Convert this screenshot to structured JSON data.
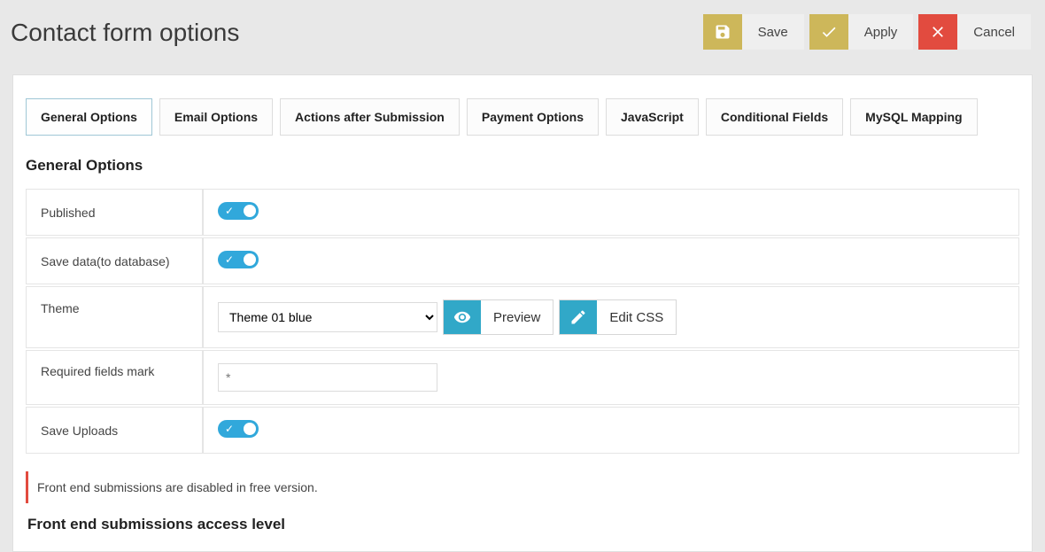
{
  "header": {
    "title": "Contact form options"
  },
  "toolbar": {
    "save_label": "Save",
    "apply_label": "Apply",
    "cancel_label": "Cancel"
  },
  "tabs": [
    {
      "id": "general",
      "label": "General Options",
      "active": true
    },
    {
      "id": "email",
      "label": "Email Options",
      "active": false
    },
    {
      "id": "actions",
      "label": "Actions after Submission",
      "active": false
    },
    {
      "id": "payment",
      "label": "Payment Options",
      "active": false
    },
    {
      "id": "javascript",
      "label": "JavaScript",
      "active": false
    },
    {
      "id": "conditional",
      "label": "Conditional Fields",
      "active": false
    },
    {
      "id": "mysql",
      "label": "MySQL Mapping",
      "active": false
    }
  ],
  "section": {
    "heading": "General Options",
    "rows": {
      "published": {
        "label": "Published",
        "on": true
      },
      "save_data": {
        "label": "Save data(to database)",
        "on": true
      },
      "theme": {
        "label": "Theme",
        "selected": "Theme 01 blue",
        "preview_label": "Preview",
        "editcss_label": "Edit CSS"
      },
      "required_mark": {
        "label": "Required fields mark",
        "placeholder": "*",
        "value": ""
      },
      "save_uploads": {
        "label": "Save Uploads",
        "on": true
      }
    }
  },
  "notice": "Front end submissions are disabled in free version.",
  "subsection": {
    "heading": "Front end submissions access level"
  }
}
